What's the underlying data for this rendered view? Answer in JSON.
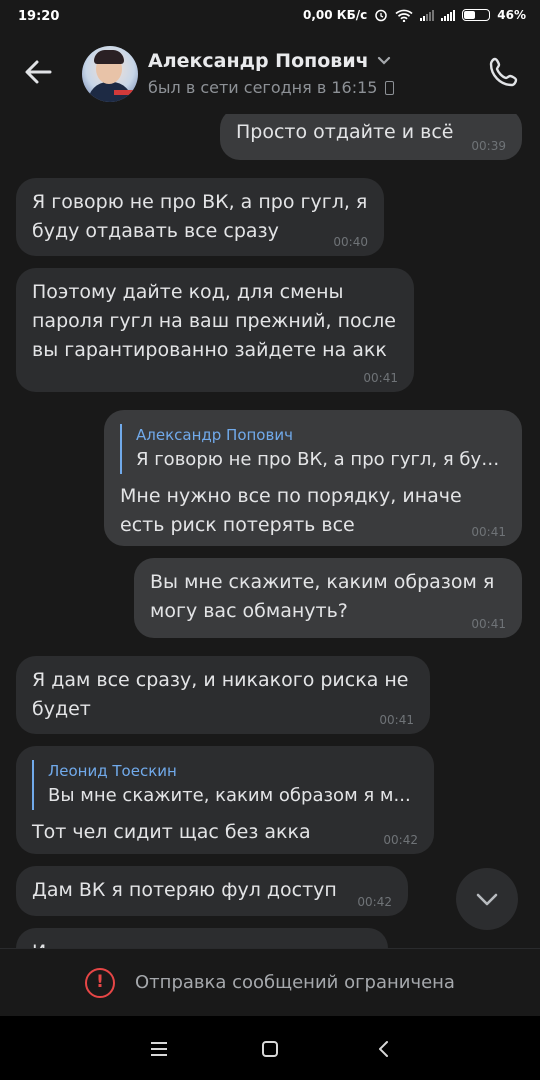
{
  "status_bar": {
    "time": "19:20",
    "speed": "0,00 КБ/с",
    "battery": "46%"
  },
  "header": {
    "contact_name": "Александр Попович",
    "contact_status": "был в сети сегодня в 16:15",
    "icons": [
      "arrow-left-icon",
      "chevron-down-icon",
      "mobile-phone-icon",
      "phone-icon"
    ]
  },
  "messages": [
    {
      "direction": "out",
      "text": "Просто отдайте и всё",
      "time": "00:39"
    },
    {
      "direction": "in",
      "text": "Я говорю не про ВК, а про гугл, я\nбуду отдавать все сразу",
      "time": "00:40"
    },
    {
      "direction": "in",
      "text": "Поэтому дайте код, для смены\nпароля гугл на ваш прежний, после\nвы гарантированно зайдете на акк",
      "time": "00:41"
    },
    {
      "direction": "out",
      "reply_author": "Александр Попович",
      "reply_text": "Я говорю не про ВК, а про гугл, я буд...",
      "text": "Мне нужно все по порядку, иначе\nесть риск потерять все",
      "time": "00:41"
    },
    {
      "direction": "out",
      "text": "Вы мне скажите, каким образом я\nмогу вас обмануть?",
      "time": "00:41"
    },
    {
      "direction": "in",
      "text": "Я дам все сразу, и никакого риска не\nбудет",
      "time": "00:41"
    },
    {
      "direction": "in",
      "reply_author": "Леонид Тоескин",
      "reply_text": "Вы мне скажите, каким образом я м...",
      "text": "Тот чел сидит щас без акка",
      "time": "00:42"
    },
    {
      "direction": "in",
      "text": "Дам ВК я потеряю фул доступ",
      "time": "00:42"
    },
    {
      "direction": "in",
      "text": "И",
      "time": ""
    }
  ],
  "restricted": {
    "label": "Отправка сообщений ограничена"
  },
  "colors": {
    "background": "#191919",
    "incoming_bubble": "#2c2d2f",
    "outgoing_bubble": "#3a3b3d",
    "reply_accent": "#71aaeb",
    "warning": "#e64646"
  }
}
